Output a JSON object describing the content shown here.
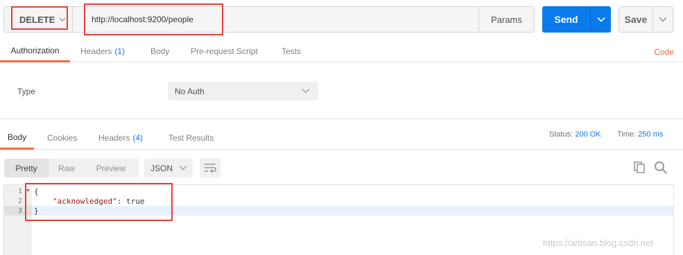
{
  "request": {
    "method": "DELETE",
    "url": "http://localhost:9200/people",
    "params_label": "Params",
    "send_label": "Send",
    "save_label": "Save"
  },
  "request_tabs": {
    "authorization": "Authorization",
    "headers": "Headers",
    "headers_count": "(1)",
    "body": "Body",
    "prerequest": "Pre-request Script",
    "tests": "Tests",
    "code": "Code"
  },
  "auth": {
    "type_label": "Type",
    "type_value": "No Auth"
  },
  "response_tabs": {
    "body": "Body",
    "cookies": "Cookies",
    "headers": "Headers",
    "headers_count": "(4)",
    "test_results": "Test Results"
  },
  "response_meta": {
    "status_label": "Status:",
    "status_value": "200 OK",
    "time_label": "Time:",
    "time_value": "250 ms"
  },
  "toolbar": {
    "pretty": "Pretty",
    "raw": "Raw",
    "preview": "Preview",
    "format": "JSON"
  },
  "code": {
    "line_numbers": [
      "1",
      "2",
      "3"
    ],
    "line1": "{",
    "line2_key": "\"acknowledged\"",
    "line2_sep": ": ",
    "line2_value": "true",
    "line3": "}"
  },
  "watermark": "https://artisan.blog.csdn.net",
  "colors": {
    "accent_blue": "#097bed",
    "accent_orange": "#f26b3a",
    "highlight_red": "#e53d3d"
  }
}
